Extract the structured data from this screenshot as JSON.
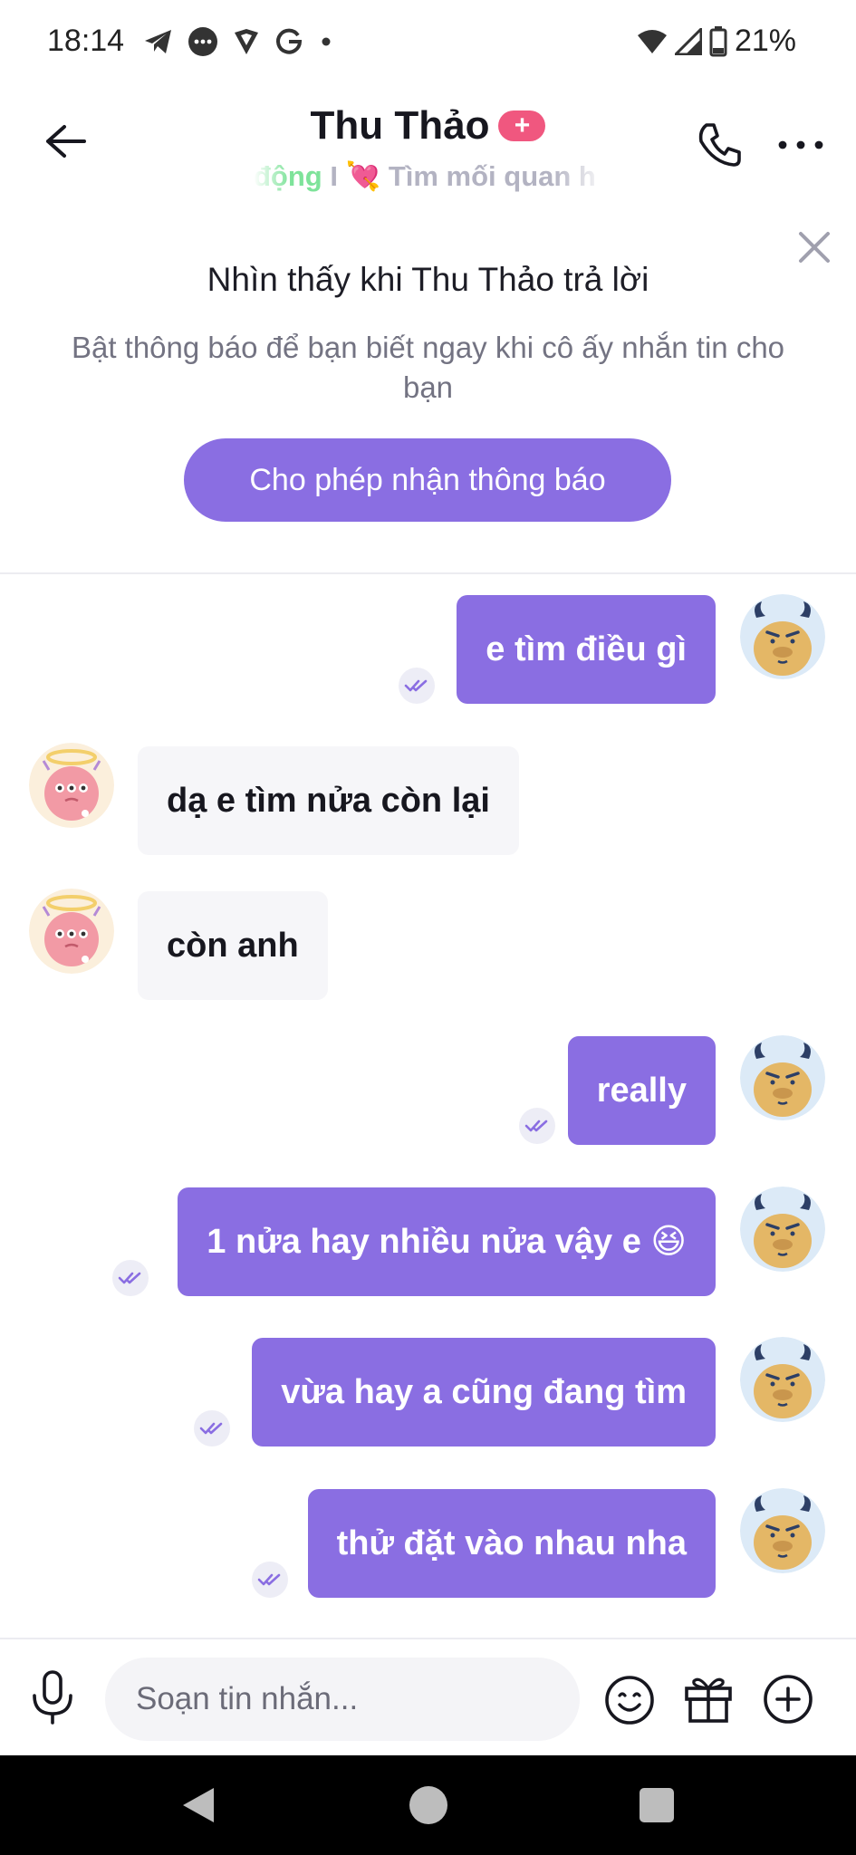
{
  "status_bar": {
    "time": "18:14",
    "battery": "21%",
    "left_icons": [
      "telegram-icon",
      "messenger-icon",
      "vpn-shield-icon",
      "google-icon",
      "dot-icon"
    ],
    "right_icons": [
      "wifi-icon",
      "signal-icon",
      "battery-icon"
    ]
  },
  "header": {
    "contact_name": "Thu Thảo",
    "badge": "+",
    "status_highlight": "động",
    "status_sep": " I ",
    "status_emoji": "💘",
    "status_text": " Tìm mối quan h"
  },
  "banner": {
    "title": "Nhìn thấy khi Thu Thảo trả lời",
    "description": "Bật thông báo để bạn biết ngay khi cô ấy nhắn tin cho bạn",
    "button_label": "Cho phép nhận thông báo"
  },
  "messages": [
    {
      "direction": "out",
      "text": "e tìm điều gì",
      "read": true
    },
    {
      "direction": "in",
      "text": "dạ e tìm nửa còn lại"
    },
    {
      "direction": "in",
      "text": "còn anh"
    },
    {
      "direction": "out",
      "text": "really",
      "read": true
    },
    {
      "direction": "out",
      "text": "1 nửa hay nhiều nửa vậy e 😆",
      "read": true
    },
    {
      "direction": "out",
      "text": "vừa hay a cũng đang tìm",
      "read": true
    },
    {
      "direction": "out",
      "text": "thử đặt vào nhau nha",
      "read": true
    }
  ],
  "composer": {
    "placeholder": "Soạn tin nhắn..."
  },
  "colors": {
    "accent": "#8a6ee2",
    "badge": "#f0577f",
    "incoming_bubble": "#f6f6f9"
  }
}
